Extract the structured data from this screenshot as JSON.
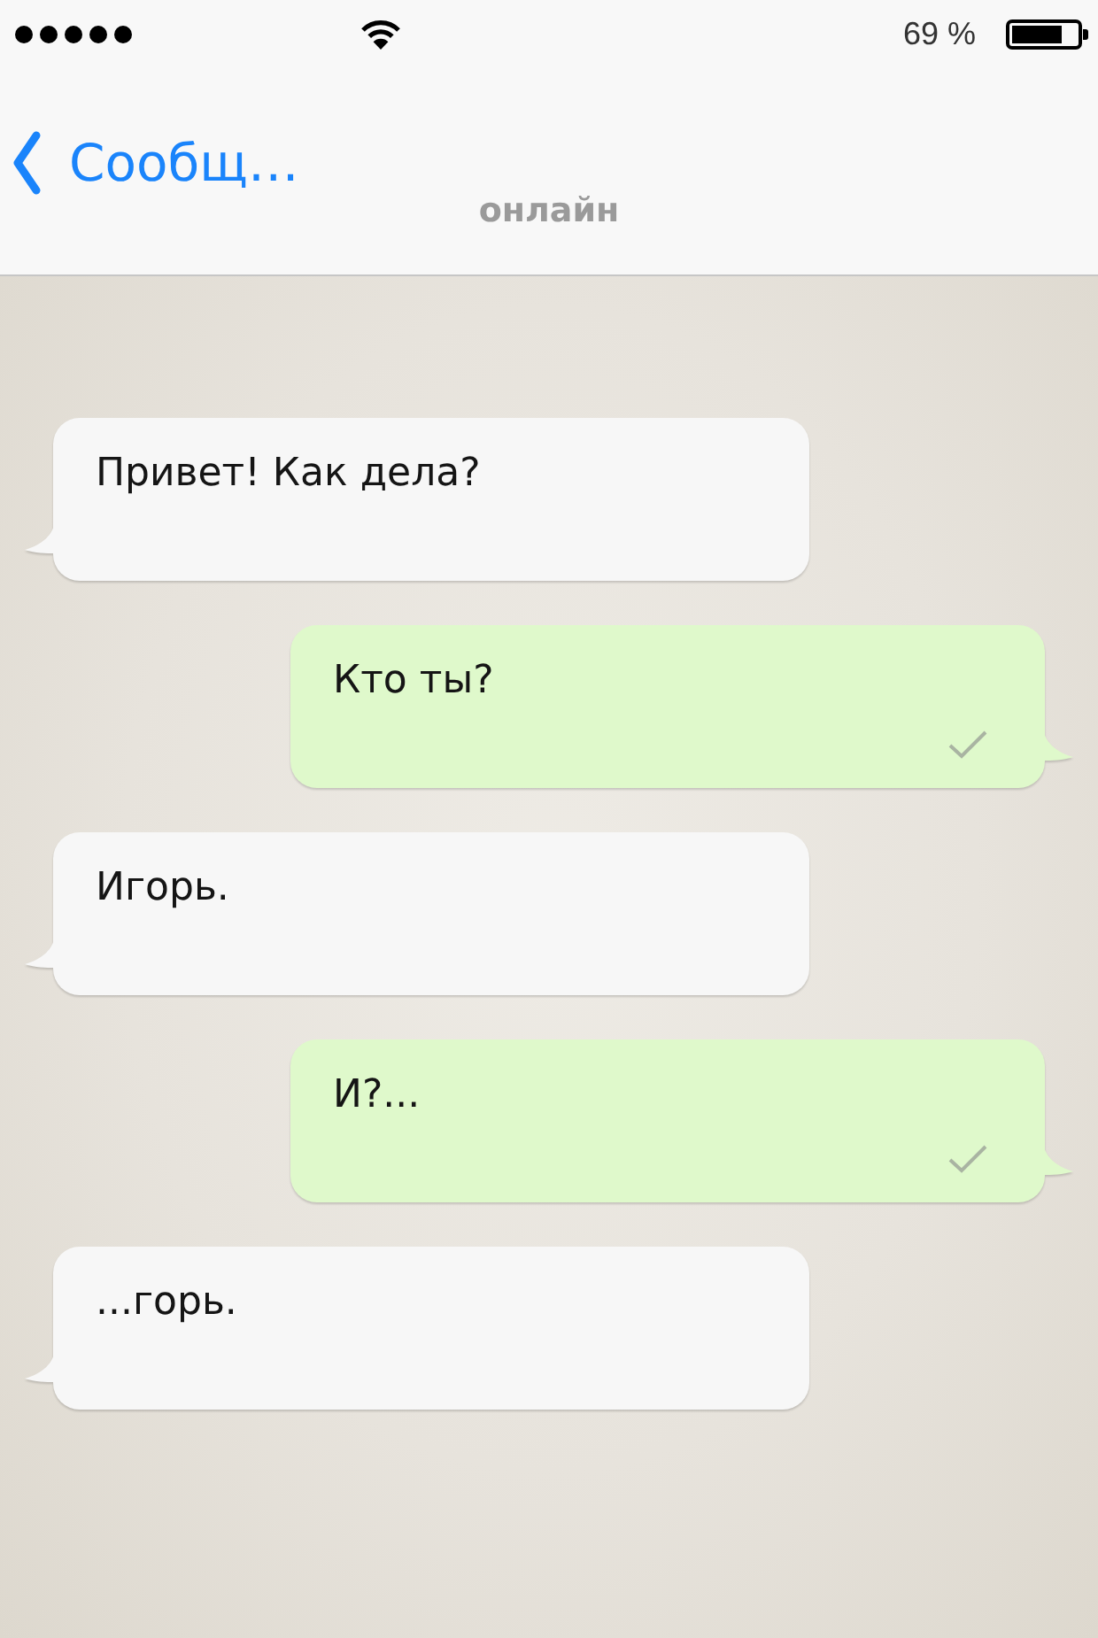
{
  "status_bar": {
    "battery_text": "69 %"
  },
  "header": {
    "back_label": "Сообщ…",
    "status": "онлайн"
  },
  "messages": [
    {
      "kind": "incoming",
      "text": "Привет! Как дела?"
    },
    {
      "kind": "outgoing",
      "text": "Кто ты?"
    },
    {
      "kind": "incoming",
      "text": "Игорь."
    },
    {
      "kind": "outgoing",
      "text": "И?..."
    },
    {
      "kind": "incoming",
      "text": "...горь."
    }
  ]
}
